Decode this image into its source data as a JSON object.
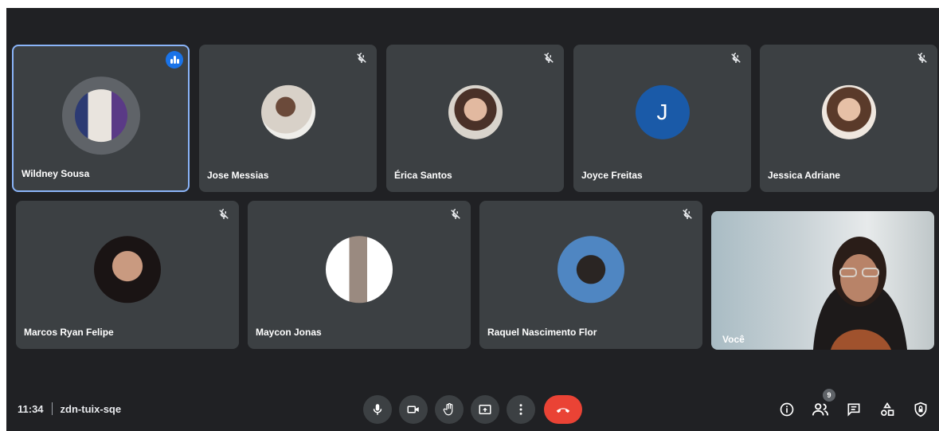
{
  "participants": [
    {
      "name": "Wildney Sousa",
      "speaking": true,
      "muted": false
    },
    {
      "name": "Jose Messias",
      "muted": true
    },
    {
      "name": "Érica Santos",
      "muted": true
    },
    {
      "name": "Joyce Freitas",
      "muted": true,
      "initial": "J"
    },
    {
      "name": "Jessica Adriane",
      "muted": true
    },
    {
      "name": "Marcos Ryan Felipe",
      "muted": true
    },
    {
      "name": "Maycon Jonas",
      "muted": true
    },
    {
      "name": "Raquel Nascimento Flor",
      "muted": true
    }
  ],
  "self": {
    "label": "Você"
  },
  "meeting": {
    "time": "11:34",
    "code": "zdn-tuix-sqe"
  },
  "people_count": "9",
  "colors": {
    "accent": "#1a73e8",
    "hangup": "#ea4335",
    "tile": "#3c4043",
    "background": "#202124"
  },
  "icons": [
    "mic-icon",
    "camera-icon",
    "raise-hand-icon",
    "present-icon",
    "more-options-icon",
    "hang-up-icon",
    "info-icon",
    "people-icon",
    "chat-icon",
    "activities-icon",
    "host-controls-icon",
    "mic-off-icon",
    "speaking-indicator-icon"
  ]
}
